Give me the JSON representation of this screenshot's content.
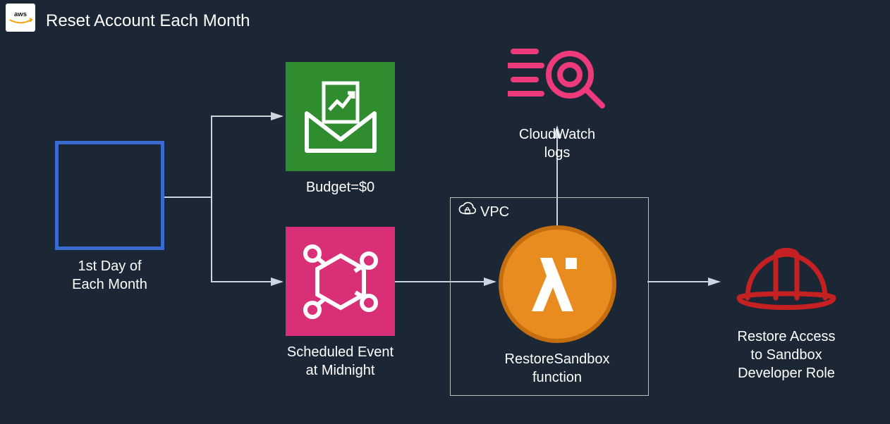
{
  "title": "Reset Account Each Month",
  "aws_label": "aws",
  "nodes": {
    "calendar": {
      "label": "1st Day of\nEach Month"
    },
    "budget": {
      "label": "Budget=$0"
    },
    "event": {
      "label": "Scheduled Event\nat Midnight"
    },
    "vpc": {
      "label": "VPC"
    },
    "lambda": {
      "label": "RestoreSandbox\nfunction"
    },
    "logs": {
      "label": "CloudWatch\nlogs"
    },
    "role": {
      "label": "Restore Access\nto Sandbox\nDeveloper Role"
    }
  },
  "edges": [
    {
      "from": "calendar",
      "to": "budget"
    },
    {
      "from": "calendar",
      "to": "event"
    },
    {
      "from": "event",
      "to": "lambda"
    },
    {
      "from": "lambda",
      "to": "logs"
    },
    {
      "from": "lambda",
      "to": "role"
    }
  ]
}
